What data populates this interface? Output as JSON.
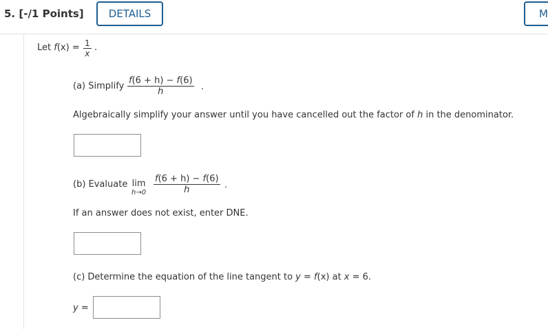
{
  "header": {
    "question_number": "5.",
    "points": "[-/1 Points]",
    "details_label": "DETAILS",
    "my_notes_label": "MY"
  },
  "intro": {
    "prefix": "Let ",
    "fn": "f",
    "arg": "(x)",
    "eq": " = ",
    "num": "1",
    "den": "x",
    "end": "."
  },
  "part_a": {
    "label": "(a) Simplify ",
    "num_f1": "f",
    "num_mid": "(6 + h) − ",
    "num_f2": "f",
    "num_end": "(6)",
    "den": "h",
    "end": ".",
    "instruction": "Algebraically simplify your answer until you have cancelled out the factor of ",
    "instruction_var": "h",
    "instruction_end": " in the denominator.",
    "answer": ""
  },
  "part_b": {
    "label": "(b) Evaluate ",
    "lim": "lim",
    "lim_sub": "h→0",
    "num_f1": "f",
    "num_mid": "(6 + h) − ",
    "num_f2": "f",
    "num_end": "(6)",
    "den": "h",
    "end": ".",
    "note": "If an answer does not exist, enter DNE.",
    "answer": ""
  },
  "part_c": {
    "label": "(c) Determine the equation of the line tangent to ",
    "y": "y",
    "eq1": " = ",
    "fx_f": "f",
    "fx_arg": "(x)",
    "at": " at ",
    "x": "x",
    "eq2": " = 6.",
    "answer_prefix_var": "y",
    "answer_prefix_eq": " =",
    "answer": ""
  },
  "colors": {
    "accent": "#1d5d90",
    "text": "#333333",
    "border": "#8c8c8c"
  }
}
